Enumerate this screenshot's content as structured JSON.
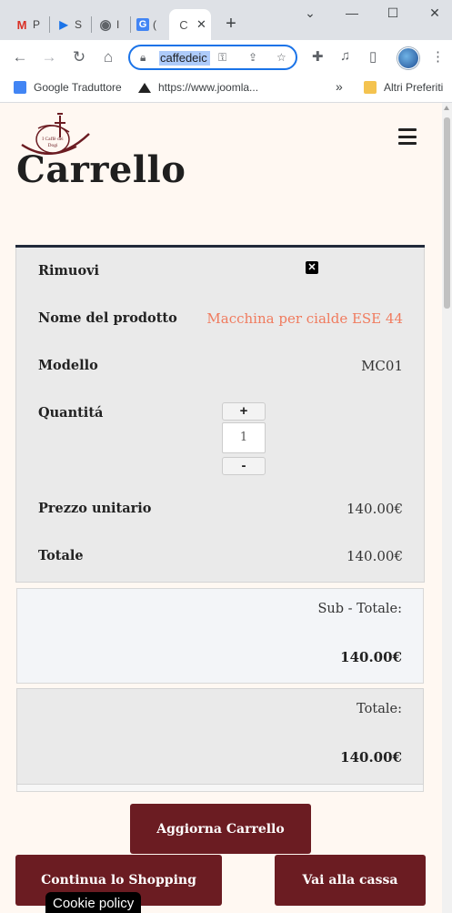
{
  "browser": {
    "tabs": [
      {
        "icon": "gmail-icon",
        "letter": "M",
        "title": "P"
      },
      {
        "icon": "play-icon",
        "letter": "▶",
        "title": "S"
      },
      {
        "icon": "globe-icon",
        "letter": "◉",
        "title": "I"
      },
      {
        "icon": "translate-icon",
        "letter": "G",
        "title": "("
      },
      {
        "icon": "page-icon",
        "letter": "C",
        "title": ""
      }
    ],
    "window_controls": {
      "minimize": "—",
      "maximize": "☐",
      "close": "✕",
      "dropdown": "⌄"
    },
    "url": "caffedeic",
    "bookmarks": [
      {
        "icon": "google-translate-icon",
        "label": "Google Traduttore"
      },
      {
        "icon": "joomla-icon",
        "label": "https://www.joomla..."
      },
      {
        "icon": "folder-icon",
        "label": "Altri Preferiti"
      }
    ],
    "bookmark_overflow": "»"
  },
  "site": {
    "logo_text": "I Caffè dei Dogi",
    "page_title": "Carrello"
  },
  "cart": {
    "labels": {
      "remove": "Rimuovi",
      "product_name": "Nome del prodotto",
      "model": "Modello",
      "quantity": "Quantitá",
      "unit_price": "Prezzo unitario",
      "total": "Totale"
    },
    "item": {
      "product_name": "Macchina per cialde ESE 44",
      "model": "MC01",
      "quantity": "1",
      "unit_price": "140.00€",
      "total": "140.00€"
    },
    "qty_plus": "+",
    "qty_minus": "-",
    "remove_symbol": "✕",
    "subtotal_label": "Sub - Totale:",
    "subtotal_value": "140.00€",
    "grand_total_label": "Totale:",
    "grand_total_value": "140.00€"
  },
  "buttons": {
    "update_cart": "Aggiorna Carrello",
    "continue_shopping": "Continua lo Shopping",
    "checkout": "Vai alla cassa"
  },
  "cookie_policy": "Cookie policy",
  "colors": {
    "brand_button": "#6b1c22",
    "product_link": "#f07b5e",
    "page_background": "#fff8f2"
  }
}
